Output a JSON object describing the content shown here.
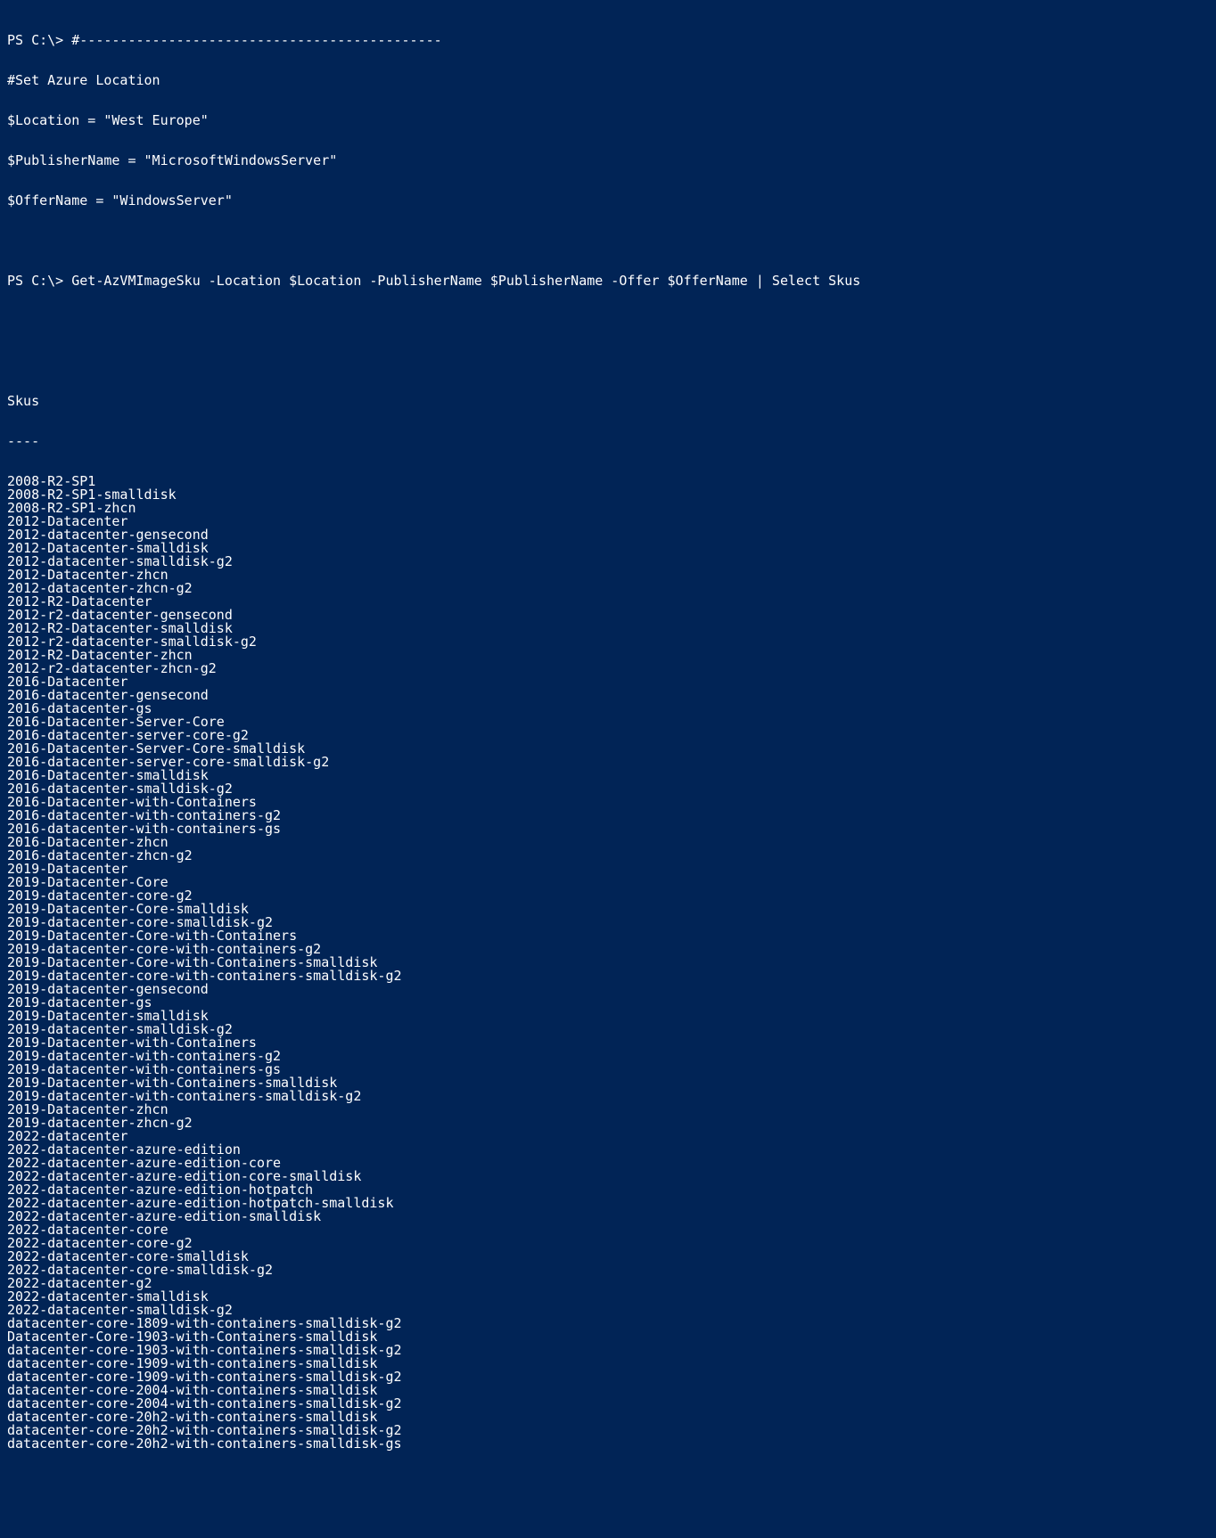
{
  "prompt": "PS C:\\> ",
  "header_lines": [
    "#---------------------------------------------",
    "#Set Azure Location",
    "$Location = \"West Europe\"",
    "$PublisherName = \"MicrosoftWindowsServer\"",
    "$OfferName = \"WindowsServer\""
  ],
  "command": "Get-AzVMImageSku -Location $Location -PublisherName $PublisherName -Offer $OfferName | Select Skus",
  "blank": "",
  "col_header": "Skus",
  "col_sep": "----",
  "skus": [
    "2008-R2-SP1",
    "2008-R2-SP1-smalldisk",
    "2008-R2-SP1-zhcn",
    "2012-Datacenter",
    "2012-datacenter-gensecond",
    "2012-Datacenter-smalldisk",
    "2012-datacenter-smalldisk-g2",
    "2012-Datacenter-zhcn",
    "2012-datacenter-zhcn-g2",
    "2012-R2-Datacenter",
    "2012-r2-datacenter-gensecond",
    "2012-R2-Datacenter-smalldisk",
    "2012-r2-datacenter-smalldisk-g2",
    "2012-R2-Datacenter-zhcn",
    "2012-r2-datacenter-zhcn-g2",
    "2016-Datacenter",
    "2016-datacenter-gensecond",
    "2016-datacenter-gs",
    "2016-Datacenter-Server-Core",
    "2016-datacenter-server-core-g2",
    "2016-Datacenter-Server-Core-smalldisk",
    "2016-datacenter-server-core-smalldisk-g2",
    "2016-Datacenter-smalldisk",
    "2016-datacenter-smalldisk-g2",
    "2016-Datacenter-with-Containers",
    "2016-datacenter-with-containers-g2",
    "2016-datacenter-with-containers-gs",
    "2016-Datacenter-zhcn",
    "2016-datacenter-zhcn-g2",
    "2019-Datacenter",
    "2019-Datacenter-Core",
    "2019-datacenter-core-g2",
    "2019-Datacenter-Core-smalldisk",
    "2019-datacenter-core-smalldisk-g2",
    "2019-Datacenter-Core-with-Containers",
    "2019-datacenter-core-with-containers-g2",
    "2019-Datacenter-Core-with-Containers-smalldisk",
    "2019-datacenter-core-with-containers-smalldisk-g2",
    "2019-datacenter-gensecond",
    "2019-datacenter-gs",
    "2019-Datacenter-smalldisk",
    "2019-datacenter-smalldisk-g2",
    "2019-Datacenter-with-Containers",
    "2019-datacenter-with-containers-g2",
    "2019-datacenter-with-containers-gs",
    "2019-Datacenter-with-Containers-smalldisk",
    "2019-datacenter-with-containers-smalldisk-g2",
    "2019-Datacenter-zhcn",
    "2019-datacenter-zhcn-g2",
    "2022-datacenter",
    "2022-datacenter-azure-edition",
    "2022-datacenter-azure-edition-core",
    "2022-datacenter-azure-edition-core-smalldisk",
    "2022-datacenter-azure-edition-hotpatch",
    "2022-datacenter-azure-edition-hotpatch-smalldisk",
    "2022-datacenter-azure-edition-smalldisk",
    "2022-datacenter-core",
    "2022-datacenter-core-g2",
    "2022-datacenter-core-smalldisk",
    "2022-datacenter-core-smalldisk-g2",
    "2022-datacenter-g2",
    "2022-datacenter-smalldisk",
    "2022-datacenter-smalldisk-g2",
    "datacenter-core-1809-with-containers-smalldisk-g2",
    "Datacenter-Core-1903-with-Containers-smalldisk",
    "datacenter-core-1903-with-containers-smalldisk-g2",
    "datacenter-core-1909-with-containers-smalldisk",
    "datacenter-core-1909-with-containers-smalldisk-g2",
    "datacenter-core-2004-with-containers-smalldisk",
    "datacenter-core-2004-with-containers-smalldisk-g2",
    "datacenter-core-20h2-with-containers-smalldisk",
    "datacenter-core-20h2-with-containers-smalldisk-g2",
    "datacenter-core-20h2-with-containers-smalldisk-gs"
  ]
}
